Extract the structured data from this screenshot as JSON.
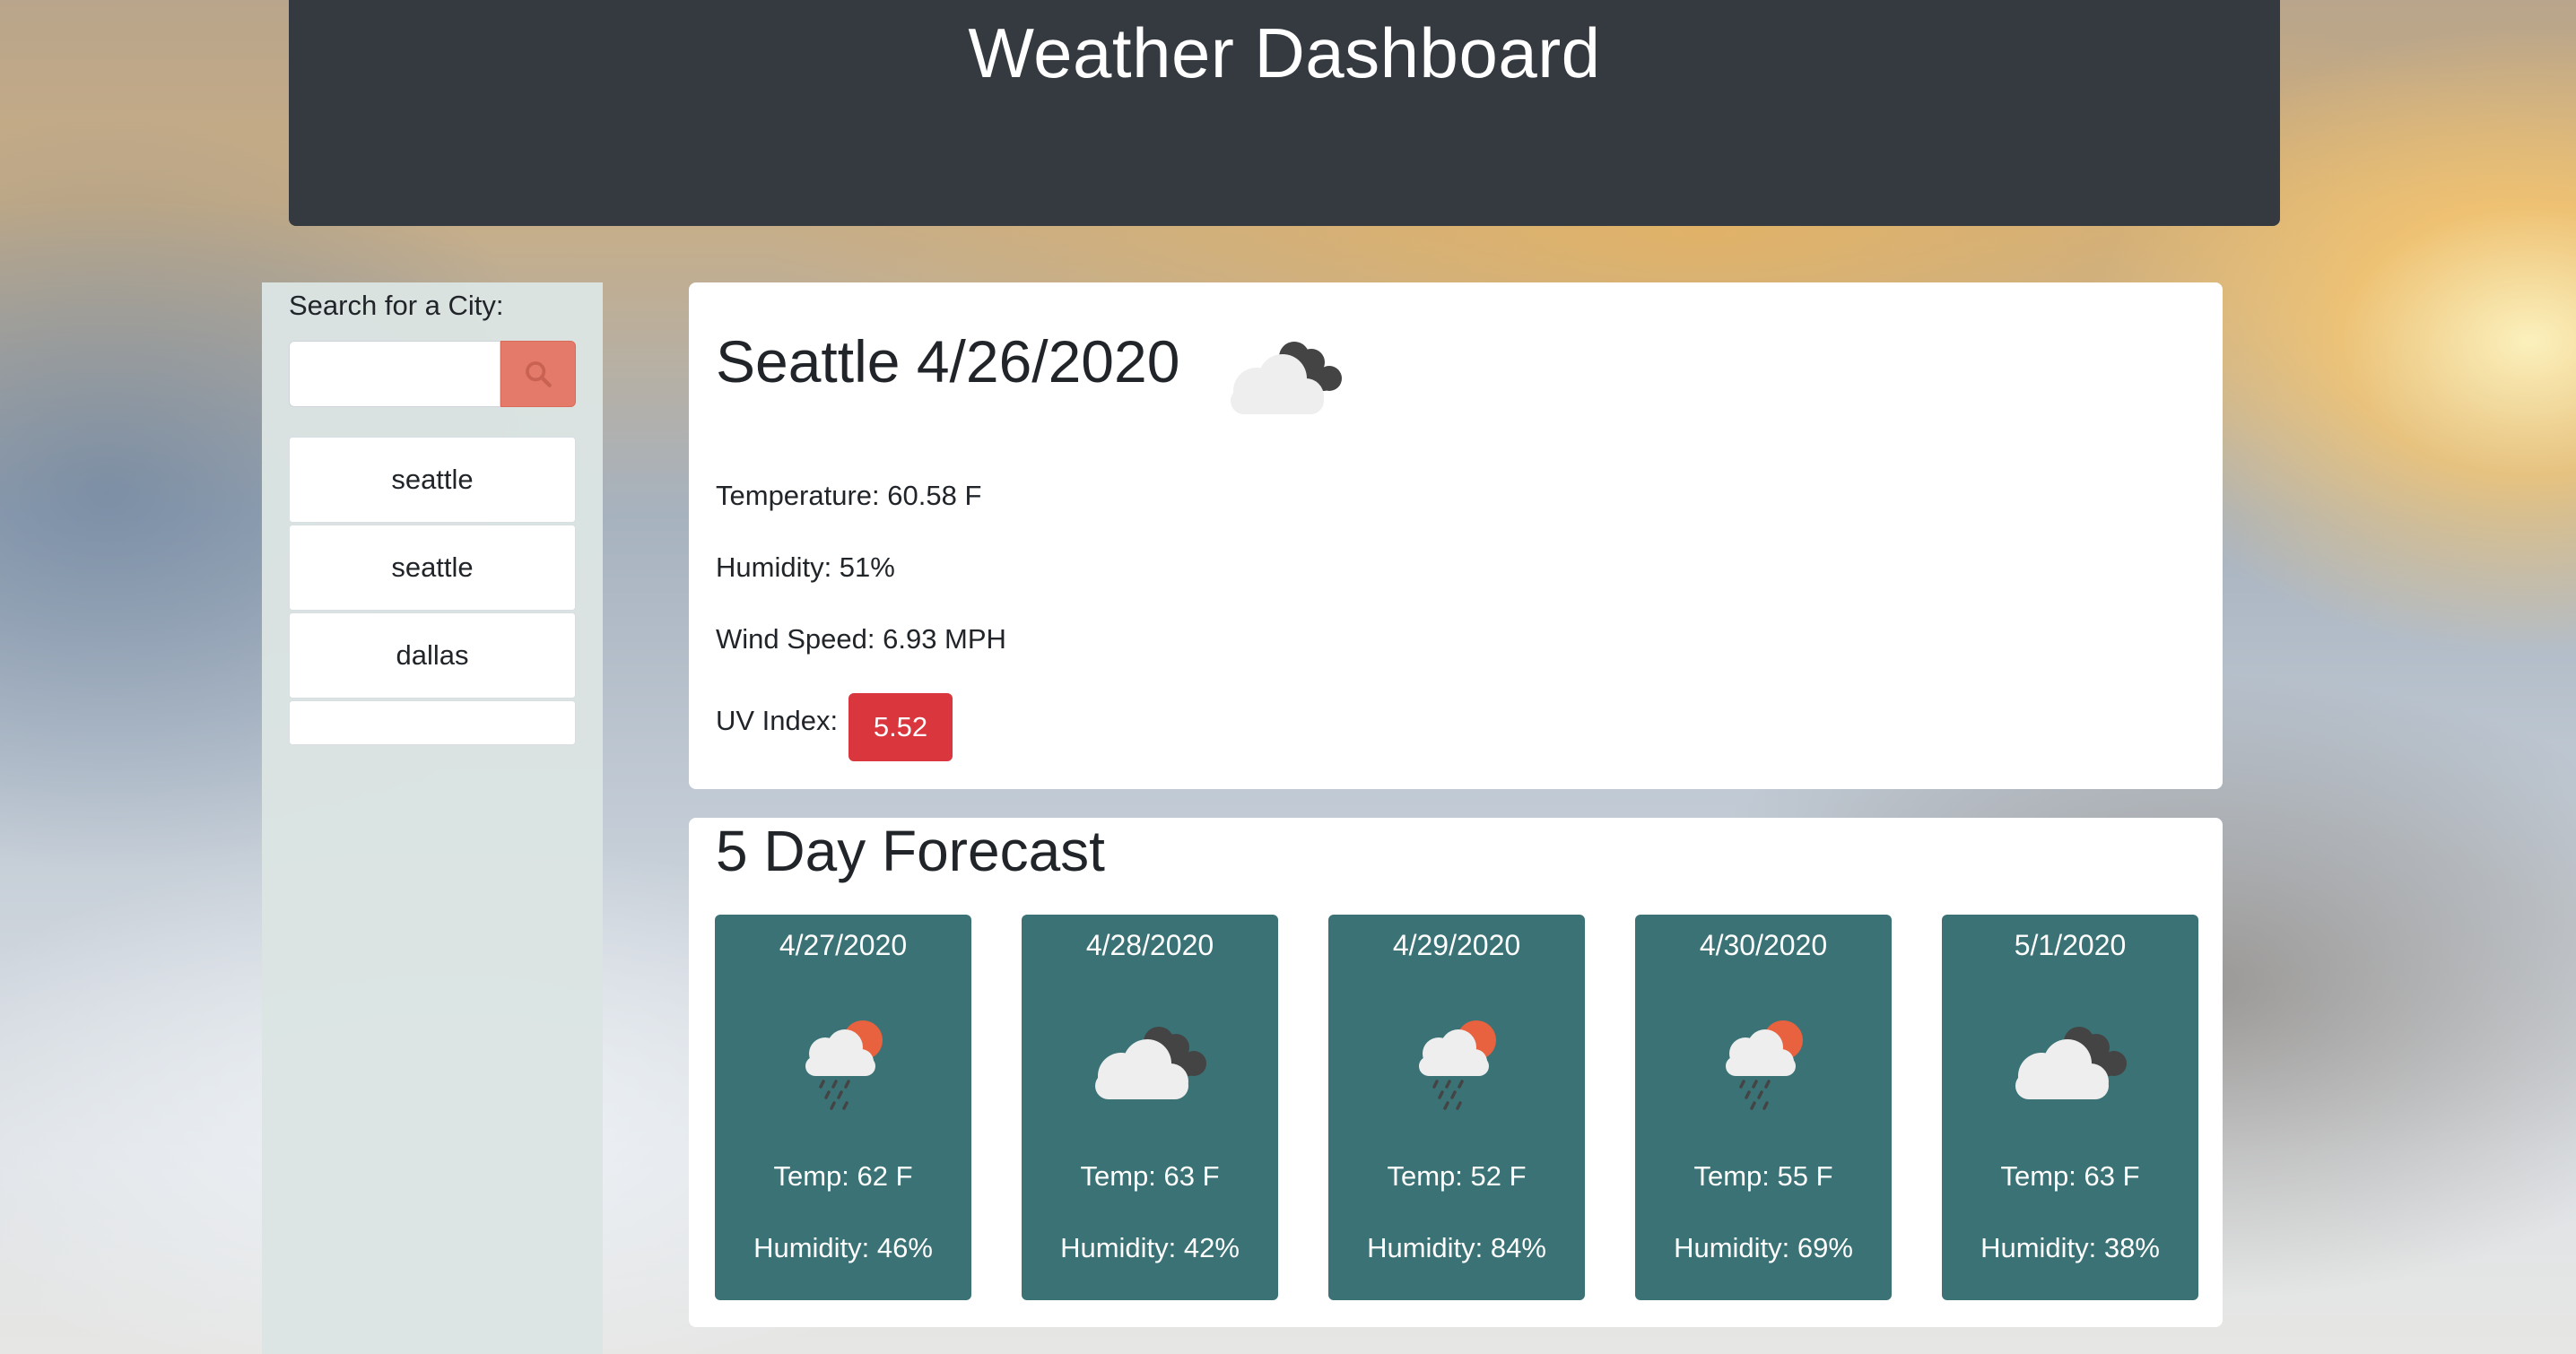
{
  "header": {
    "title": "Weather Dashboard"
  },
  "search": {
    "label": "Search for a City:",
    "input_value": "",
    "button_icon": "search-icon",
    "button_color": "#e37a6a"
  },
  "history": [
    {
      "label": "seattle"
    },
    {
      "label": "seattle"
    },
    {
      "label": "dallas"
    },
    {
      "label": ""
    }
  ],
  "current": {
    "title": "Seattle 4/26/2020",
    "icon": "broken-clouds-icon",
    "temperature": "Temperature: 60.58 F",
    "humidity": "Humidity: 51%",
    "wind": "Wind Speed: 6.93 MPH",
    "uv_label": "UV Index:",
    "uv_value": "5.52",
    "uv_color": "#d9363e"
  },
  "forecast": {
    "title": "5 Day Forecast",
    "card_color": "#3a7275",
    "days": [
      {
        "date": "4/27/2020",
        "icon": "rain-sun-icon",
        "temp": "Temp: 62 F",
        "humidity": "Humidity: 46%"
      },
      {
        "date": "4/28/2020",
        "icon": "broken-clouds-icon",
        "temp": "Temp: 63 F",
        "humidity": "Humidity: 42%"
      },
      {
        "date": "4/29/2020",
        "icon": "rain-sun-icon",
        "temp": "Temp: 52 F",
        "humidity": "Humidity: 84%"
      },
      {
        "date": "4/30/2020",
        "icon": "rain-sun-icon",
        "temp": "Temp: 55 F",
        "humidity": "Humidity: 69%"
      },
      {
        "date": "5/1/2020",
        "icon": "broken-clouds-icon",
        "temp": "Temp: 63 F",
        "humidity": "Humidity: 38%"
      }
    ]
  }
}
